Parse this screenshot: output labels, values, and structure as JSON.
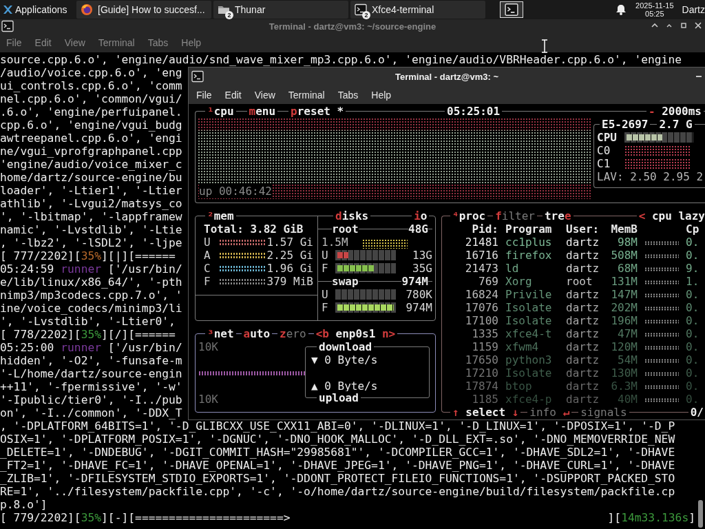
{
  "panel": {
    "menu_label": "Applications",
    "tasks": [
      {
        "kind": "browser",
        "label": "[Guide] How to succesf..."
      },
      {
        "kind": "files",
        "label": "Thunar",
        "badge": "2"
      },
      {
        "kind": "terminal",
        "label": "Xfce4-terminal",
        "badge": "2"
      }
    ],
    "date": "2025-11-15",
    "time": "05:25",
    "user": "Dartz"
  },
  "back_window": {
    "title": "Terminal - dartz@vm3: ~/source-engine",
    "menu": [
      "File",
      "Edit",
      "View",
      "Terminal",
      "Tabs",
      "Help"
    ],
    "lines": [
      {
        "parts": [
          {
            "text": "source.cpp.6.o', 'engine/audio/snd_wave_mixer_mp3.cpp.6.o', 'engine/audio/VBRHeader.cpp.6.o', 'engine"
          }
        ]
      },
      {
        "parts": [
          {
            "text": "/audio/voice.cpp.6.o', 'eng"
          }
        ]
      },
      {
        "parts": [
          {
            "text": "ui_controls.cpp.6.o', 'comm"
          }
        ]
      },
      {
        "parts": [
          {
            "text": "nel.cpp.6.o', 'common/vgui/"
          }
        ]
      },
      {
        "parts": [
          {
            "text": ".6.o', 'engine/perfuipanel."
          }
        ]
      },
      {
        "parts": [
          {
            "text": "cpp.6.o', 'engine/vgui_budg"
          }
        ]
      },
      {
        "parts": [
          {
            "text": "awtreepanel.cpp.6.o', 'engi"
          }
        ]
      },
      {
        "parts": [
          {
            "text": "ne/vgui_vprofgraphpanel.cpp"
          }
        ]
      },
      {
        "parts": [
          {
            "text": "'engine/audio/voice_mixer_c"
          }
        ]
      },
      {
        "parts": [
          {
            "text": "home/dartz/source-engine/bu"
          }
        ]
      },
      {
        "parts": [
          {
            "text": "loader', '-Ltier1', '-Ltier"
          }
        ]
      },
      {
        "parts": [
          {
            "text": "athlib', '-Lvgui2/matsys_co"
          }
        ]
      },
      {
        "parts": [
          {
            "text": "', '-lbitmap', '-lappframew"
          }
        ]
      },
      {
        "parts": [
          {
            "text": "namic', '-Lvstdlib', '-Ltie"
          }
        ]
      },
      {
        "parts": [
          {
            "text": ", '-lbz2', '-lSDL2', '-ljpe"
          }
        ]
      },
      {
        "parts": [
          {
            "text": "[ 777/2202]["
          },
          {
            "text": "35%",
            "color": "#b8692a"
          },
          {
            "text": "][|][======"
          }
        ]
      },
      {
        "parts": [
          {
            "text": "05:24:59 "
          },
          {
            "text": "runner",
            "color": "#7c3a9e"
          },
          {
            "text": " ['/usr/bin/"
          }
        ]
      },
      {
        "parts": [
          {
            "text": "e/lib/linux/x86_64/', '-pth"
          }
        ]
      },
      {
        "parts": [
          {
            "text": "nimp3/mp3codecs.cpp.7.o', '"
          }
        ]
      },
      {
        "parts": [
          {
            "text": "ine/voice_codecs/minimp3/li"
          }
        ]
      },
      {
        "parts": [
          {
            "text": "', '-Lvstdlib', '-Ltier0',"
          }
        ]
      },
      {
        "parts": [
          {
            "text": "[ 778/2202]["
          },
          {
            "text": "35%",
            "color": "#3c9a3c"
          },
          {
            "text": "][/][======"
          }
        ]
      },
      {
        "parts": [
          {
            "text": "05:25:00 "
          },
          {
            "text": "runner",
            "color": "#7c3a9e"
          },
          {
            "text": " ['/usr/bin/"
          }
        ]
      },
      {
        "parts": [
          {
            "text": "hidden', '-O2', '-funsafe-m"
          }
        ]
      },
      {
        "parts": [
          {
            "text": "'-L/home/dartz/source-engin"
          }
        ]
      },
      {
        "parts": [
          {
            "text": "++11', '-fpermissive', '-w'"
          }
        ]
      },
      {
        "parts": [
          {
            "text": "'-Ipublic/tier0', '-I../pub"
          }
        ]
      },
      {
        "parts": [
          {
            "text": "on', '-I../common', '-DDX_T"
          }
        ]
      },
      {
        "parts": [
          {
            "text": ", '-DPLATFORM_64BITS=1', '-D_GLIBCXX_USE_CXX11_ABI=0', '-DLINUX=1', '-D_LINUX=1', '-DPOSIX=1', '-D_P"
          }
        ]
      },
      {
        "parts": [
          {
            "text": "OSIX=1', '-DPLATFORM_POSIX=1', '-DGNUC', '-DNO_HOOK_MALLOC', '-D_DLL_EXT=.so', '-DNO_MEMOVERRIDE_NEW"
          }
        ]
      },
      {
        "parts": [
          {
            "text": "_DELETE=1', '-DNDEBUG', '-DGIT_COMMIT_HASH=\"29985681\"', '-DCOMPILER_GCC=1', '-DHAVE_SDL2=1', '-DHAVE"
          }
        ]
      },
      {
        "parts": [
          {
            "text": "_FT2=1', '-DHAVE_FC=1', '-DHAVE_OPENAL=1', '-DHAVE_JPEG=1', '-DHAVE_PNG=1', '-DHAVE_CURL=1', '-DHAVE"
          }
        ]
      },
      {
        "parts": [
          {
            "text": "_ZLIB=1', '-DFILESYSTEM_STDIO_EXPORTS=1', '-DDONT_PROTECT_FILEIO_FUNCTIONS=1', '-DSUPPORT_PACKED_STO"
          }
        ]
      },
      {
        "parts": [
          {
            "text": "RE=1', '../filesystem/packfile.cpp', '-c', '-o/home/dartz/source-engine/build/filesystem/packfile.cp"
          }
        ]
      },
      {
        "parts": [
          {
            "text": "p.8.o']"
          }
        ]
      },
      {
        "parts": [
          {
            "text": "[ 779/2202]["
          },
          {
            "text": "35%",
            "color": "#3c9a3c"
          },
          {
            "text": "][-][======================>"
          }
        ],
        "right_parts": [
          {
            "text": "]["
          },
          {
            "text": "14m33.136s",
            "color": "#3c9a3c"
          },
          {
            "text": "]"
          }
        ]
      }
    ]
  },
  "front_window": {
    "title": "Terminal - dartz@vm3: ~",
    "menu": [
      "File",
      "Edit",
      "View",
      "Terminal",
      "Tabs",
      "Help"
    ],
    "cpu": {
      "tabs": [
        {
          "parts": [
            {
              "text": "¹",
              "accent": true
            },
            {
              "text": "cpu"
            }
          ]
        },
        {
          "parts": [
            {
              "text": "m",
              "accent": true
            },
            {
              "text": "enu"
            }
          ]
        },
        {
          "parts": [
            {
              "text": "p",
              "accent": true
            },
            {
              "text": "reset *"
            }
          ]
        }
      ],
      "clock": "05:25:01",
      "interval": [
        {
          "text": "-",
          "accent": true
        },
        {
          "text": " 2000ms"
        }
      ],
      "uptime": "up 00:46:42",
      "model": "E5-2697",
      "freq": "2.7 G",
      "meter_label": "CPU",
      "level": 0.55,
      "cores": [
        "C0",
        "C1"
      ],
      "load": "LAV: 2.50 2.95 2"
    },
    "mem": {
      "tabs": [
        {
          "parts": [
            {
              "text": "²",
              "accent": true
            },
            {
              "text": "mem"
            }
          ]
        }
      ],
      "total": "Total: 3.82 GiB",
      "rows": [
        {
          "label": "U",
          "value": "1.57 Gi",
          "color": "#c86a6a"
        },
        {
          "label": "A",
          "value": "2.25 Gi",
          "color": "#d2b24e"
        },
        {
          "label": "C",
          "value": "1.96 Gi",
          "color": "#6cb8d6"
        },
        {
          "label": "F",
          "value": "379 MiB",
          "color": "#8a8a8a"
        }
      ]
    },
    "disks": {
      "tabs": [
        {
          "parts": [
            {
              "text": "d",
              "accent": true
            },
            {
              "text": "isks"
            }
          ]
        },
        {
          "parts": [
            {
              "text": "i",
              "accent": true
            },
            {
              "text": "o"
            }
          ]
        }
      ],
      "volumes": [
        {
          "name": "root",
          "size": "48G",
          "io": "1.5M",
          "meters": [
            {
              "label": "U",
              "value": "13G",
              "level": 0.2,
              "color": "#c84646"
            },
            {
              "label": "F",
              "value": "35G",
              "level": 0.65,
              "color": "#86c04e"
            }
          ]
        },
        {
          "name": "swap",
          "size": "974M",
          "meters": [
            {
              "label": "U",
              "value": "780K",
              "level": 0
            },
            {
              "label": "F",
              "value": "974M",
              "level": 1,
              "color": "#a8d860"
            }
          ]
        }
      ]
    },
    "net": {
      "tabs": [
        {
          "parts": [
            {
              "text": "³",
              "accent": true
            },
            {
              "text": "net"
            }
          ]
        },
        {
          "parts": [
            {
              "text": "a",
              "accent": true
            },
            {
              "text": "uto"
            }
          ]
        },
        {
          "parts": [
            {
              "text": "z",
              "accent": true
            },
            {
              "text": "ero",
              "dim": true
            }
          ]
        },
        {
          "parts": [
            {
              "text": "<b",
              "accent": true
            },
            {
              "text": " enp0s1 "
            },
            {
              "text": "n>",
              "accent": true
            }
          ]
        }
      ],
      "scale_top": "10K",
      "scale_bottom": "10K",
      "download": {
        "label": "download",
        "rate": "▼ 0 Byte/s"
      },
      "upload": {
        "label": "upload",
        "rate": "▲ 0 Byte/s"
      }
    },
    "proc": {
      "tabs": [
        {
          "parts": [
            {
              "text": "⁴",
              "accent": true
            },
            {
              "text": "proc"
            }
          ]
        },
        {
          "parts": [
            {
              "text": "f",
              "accent": true
            },
            {
              "text": "ilter",
              "dim": true
            }
          ]
        },
        {
          "parts": [
            {
              "text": "tre"
            },
            {
              "text": "e",
              "accent": true
            }
          ]
        },
        {
          "parts": [
            {
              "text": "<",
              "accent": true
            },
            {
              "text": " cpu lazy"
            }
          ]
        }
      ],
      "columns": [
        "Pid:",
        "Program",
        "User:",
        "MemB",
        "Cp"
      ],
      "rows": [
        {
          "pid": "21481",
          "program": "cc1plus",
          "user": "dartz",
          "mem": "98M",
          "cpu": "0."
        },
        {
          "pid": "16716",
          "program": "firefox",
          "user": "dartz",
          "mem": "508M",
          "cpu": "0."
        },
        {
          "pid": "21473",
          "program": "ld",
          "user": "dartz",
          "mem": "68M",
          "cpu": "9."
        },
        {
          "pid": "769",
          "program": "Xorg",
          "user": "root",
          "mem": "131M",
          "cpu": "1."
        },
        {
          "pid": "16824",
          "program": "Privile",
          "user": "dartz",
          "mem": "147M",
          "cpu": "0."
        },
        {
          "pid": "17076",
          "program": "Isolate",
          "user": "dartz",
          "mem": "202M",
          "cpu": "0."
        },
        {
          "pid": "17100",
          "program": "Isolate",
          "user": "dartz",
          "mem": "196M",
          "cpu": "0."
        },
        {
          "pid": "1335",
          "program": "xfce4-t",
          "user": "dartz",
          "mem": "47M",
          "cpu": "0."
        },
        {
          "pid": "1159",
          "program": "xfwm4",
          "user": "dartz",
          "mem": "120M",
          "cpu": "0."
        },
        {
          "pid": "17650",
          "program": "python3",
          "user": "dartz",
          "mem": "54M",
          "cpu": "0."
        },
        {
          "pid": "17210",
          "program": "Isolate",
          "user": "dartz",
          "mem": "130M",
          "cpu": "0."
        },
        {
          "pid": "17874",
          "program": "btop",
          "user": "dartz",
          "mem": "6.3M",
          "cpu": "0."
        },
        {
          "pid": "1185",
          "program": "xfce4-p",
          "user": "dartz",
          "mem": "40M",
          "cpu": "0."
        }
      ],
      "footer": [
        {
          "parts": [
            {
              "text": "↑",
              "accent": true
            },
            {
              "text": " select "
            },
            {
              "text": "↓",
              "accent": true
            }
          ]
        },
        {
          "parts": [
            {
              "text": "info ",
              "dim": true
            },
            {
              "text": "↵",
              "accent": true
            }
          ]
        },
        {
          "parts": [
            {
              "text": "signals",
              "dim": true
            }
          ]
        }
      ],
      "count": "0/"
    }
  }
}
